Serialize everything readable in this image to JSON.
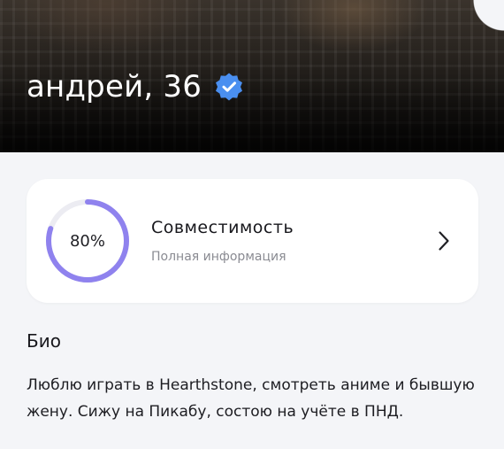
{
  "profile": {
    "name_age": "андрей, 36",
    "verified_icon": "verified-badge-icon",
    "accent_color": "#4a8ff0"
  },
  "compatibility": {
    "percent_label": "80%",
    "percent_value": 80,
    "title": "Совместимость",
    "subtitle": "Полная информация",
    "ring_color": "#8f82ee",
    "ring_track_color": "#ececf2",
    "chevron_icon": "chevron-right-icon"
  },
  "bio": {
    "title": "Био",
    "text": "Люблю играть в Hearthstone, смотреть аниме и бывшую жену. Сижу на Пикабу, состою на учёте в ПНД."
  }
}
